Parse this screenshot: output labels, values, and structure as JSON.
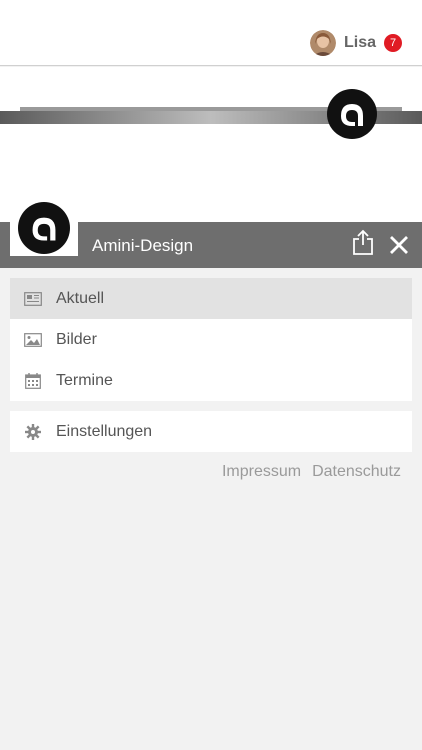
{
  "user": {
    "name": "Lisa",
    "notifications": "7"
  },
  "header": {
    "title": "Amini-Design"
  },
  "menu": {
    "primary": [
      {
        "label": "Aktuell",
        "icon": "newspaper-icon",
        "active": true
      },
      {
        "label": "Bilder",
        "icon": "image-icon",
        "active": false
      },
      {
        "label": "Termine",
        "icon": "calendar-icon",
        "active": false
      }
    ],
    "secondary": [
      {
        "label": "Einstellungen",
        "icon": "gear-icon",
        "active": false
      }
    ]
  },
  "footer": {
    "impressum": "Impressum",
    "datenschutz": "Datenschutz"
  },
  "colors": {
    "header_bg": "#6e6e6e",
    "badge": "#e01b24",
    "active_row": "#e2e2e2"
  }
}
